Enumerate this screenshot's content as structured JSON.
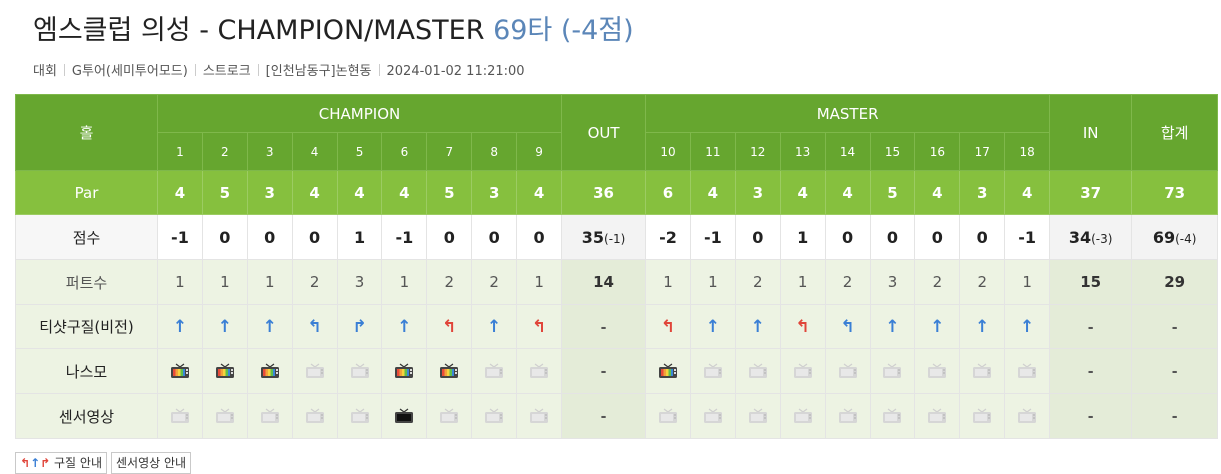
{
  "page": {
    "title_main": "엠스클럽 의성 - CHAMPION/MASTER",
    "title_score": "69타 (-4점)",
    "meta": [
      "대회",
      "G투어(세미투어모드)",
      "스트로크",
      "[인천남동구]논현동",
      "2024-01-02 11:21:00"
    ]
  },
  "card": {
    "hole_label": "홀",
    "course_front": "CHAMPION",
    "course_back": "MASTER",
    "out_label": "OUT",
    "in_label": "IN",
    "total_label": "합계",
    "holes_front": [
      "1",
      "2",
      "3",
      "4",
      "5",
      "6",
      "7",
      "8",
      "9"
    ],
    "holes_back": [
      "10",
      "11",
      "12",
      "13",
      "14",
      "15",
      "16",
      "17",
      "18"
    ],
    "par": {
      "label": "Par",
      "front": [
        "4",
        "5",
        "3",
        "4",
        "4",
        "4",
        "5",
        "3",
        "4"
      ],
      "out": "36",
      "back": [
        "6",
        "4",
        "3",
        "4",
        "4",
        "5",
        "4",
        "3",
        "4"
      ],
      "in": "37",
      "total": "73"
    },
    "score": {
      "label": "점수",
      "front": [
        "-1",
        "0",
        "0",
        "0",
        "1",
        "-1",
        "0",
        "0",
        "0"
      ],
      "out": "35",
      "out_rel": "(-1)",
      "back": [
        "-2",
        "-1",
        "0",
        "1",
        "0",
        "0",
        "0",
        "0",
        "-1"
      ],
      "in": "34",
      "in_rel": "(-3)",
      "total": "69",
      "total_rel": "(-4)"
    },
    "putts": {
      "label": "퍼트수",
      "front": [
        "1",
        "1",
        "1",
        "2",
        "3",
        "1",
        "2",
        "2",
        "1"
      ],
      "out": "14",
      "back": [
        "1",
        "1",
        "2",
        "1",
        "2",
        "3",
        "2",
        "2",
        "1"
      ],
      "in": "15",
      "total": "29"
    },
    "tee": {
      "label": "티샷구질(비전)",
      "front": [
        {
          "icon": "arrow-straight-icon",
          "color": "#3a7fd5"
        },
        {
          "icon": "arrow-straight-icon",
          "color": "#3a7fd5"
        },
        {
          "icon": "arrow-straight-icon",
          "color": "#3a7fd5"
        },
        {
          "icon": "arrow-hook-left-icon",
          "color": "#3a7fd5"
        },
        {
          "icon": "arrow-slice-right-icon",
          "color": "#3a7fd5"
        },
        {
          "icon": "arrow-straight-icon",
          "color": "#3a7fd5"
        },
        {
          "icon": "arrow-hook-left-icon",
          "color": "#e0453a"
        },
        {
          "icon": "arrow-straight-icon",
          "color": "#3a7fd5"
        },
        {
          "icon": "arrow-hook-left-icon",
          "color": "#e0453a"
        }
      ],
      "out": "-",
      "back": [
        {
          "icon": "arrow-hook-left-icon",
          "color": "#e0453a"
        },
        {
          "icon": "arrow-straight-icon",
          "color": "#3a7fd5"
        },
        {
          "icon": "arrow-straight-icon",
          "color": "#3a7fd5"
        },
        {
          "icon": "arrow-hook-left-icon",
          "color": "#e0453a"
        },
        {
          "icon": "arrow-hook-left-icon",
          "color": "#3a7fd5"
        },
        {
          "icon": "arrow-straight-icon",
          "color": "#3a7fd5"
        },
        {
          "icon": "arrow-straight-icon",
          "color": "#3a7fd5"
        },
        {
          "icon": "arrow-straight-icon",
          "color": "#3a7fd5"
        },
        {
          "icon": "arrow-straight-icon",
          "color": "#3a7fd5"
        }
      ],
      "in": "-",
      "total": "-"
    },
    "nasmo": {
      "label": "나스모",
      "front": [
        "active",
        "active",
        "active",
        "inactive",
        "inactive",
        "active",
        "active",
        "inactive",
        "inactive"
      ],
      "out": "-",
      "back": [
        "active",
        "inactive",
        "inactive",
        "inactive",
        "inactive",
        "inactive",
        "inactive",
        "inactive",
        "inactive"
      ],
      "in": "-",
      "total": "-"
    },
    "sensor": {
      "label": "센서영상",
      "front": [
        "inactive",
        "inactive",
        "inactive",
        "inactive",
        "inactive",
        "dark",
        "inactive",
        "inactive",
        "inactive"
      ],
      "out": "-",
      "back": [
        "inactive",
        "inactive",
        "inactive",
        "inactive",
        "inactive",
        "inactive",
        "inactive",
        "inactive",
        "inactive"
      ],
      "in": "-",
      "total": "-"
    }
  },
  "footer": {
    "shot_guide": "구질 안내",
    "sensor_guide": "센서영상 안내"
  },
  "colors": {
    "header_green": "#66a62f",
    "par_green": "#86c03e",
    "light_green": "#edf3e3",
    "score_blue": "#5b86b8",
    "arrow_blue": "#3a7fd5",
    "arrow_red": "#e0453a"
  }
}
